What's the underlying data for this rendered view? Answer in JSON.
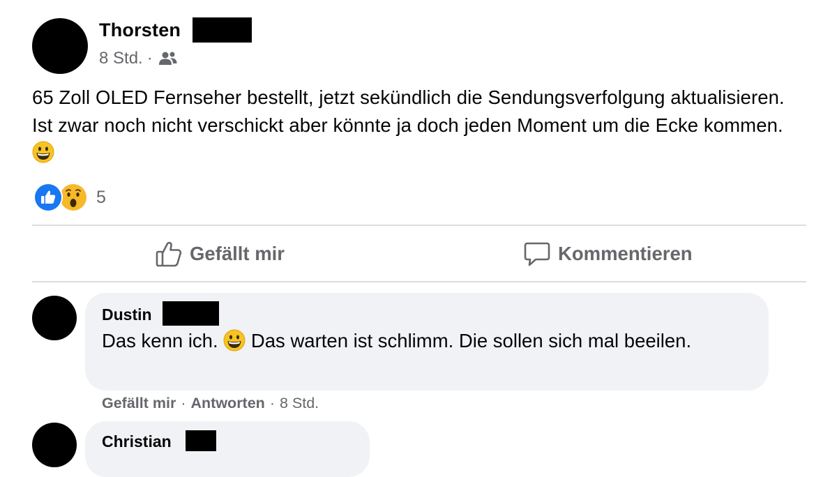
{
  "post": {
    "author": "Thorsten",
    "time": "8 Std.",
    "separator": "·",
    "audience_icon": "friends-icon",
    "text_parts": [
      "65 Zoll OLED Fernseher bestellt, jetzt sekündlich die Sendungsverfolgung aktualisieren. Ist zwar noch nicht verschickt aber könnte ja doch jeden Moment um die Ecke kommen. "
    ],
    "emoji": "grinning-face-emoji",
    "reactions": {
      "types": [
        "like",
        "wow"
      ],
      "count": "5"
    }
  },
  "actions": {
    "like_label": "Gefällt mir",
    "comment_label": "Kommentieren"
  },
  "comments": [
    {
      "author": "Dustin",
      "text_before_emoji": "Das kenn ich. ",
      "text_after_emoji": " Das warten ist schlimm. Die sollen sich mal beeilen.",
      "like_label": "Gefällt mir",
      "reply_label": "Antworten",
      "time": "8 Std.",
      "separator": "·"
    },
    {
      "author": "Christian"
    }
  ],
  "colors": {
    "secondary_text": "#65676b",
    "bubble_bg": "#f0f2f5",
    "divider": "#dadde1",
    "like_blue": "#1877f2"
  }
}
